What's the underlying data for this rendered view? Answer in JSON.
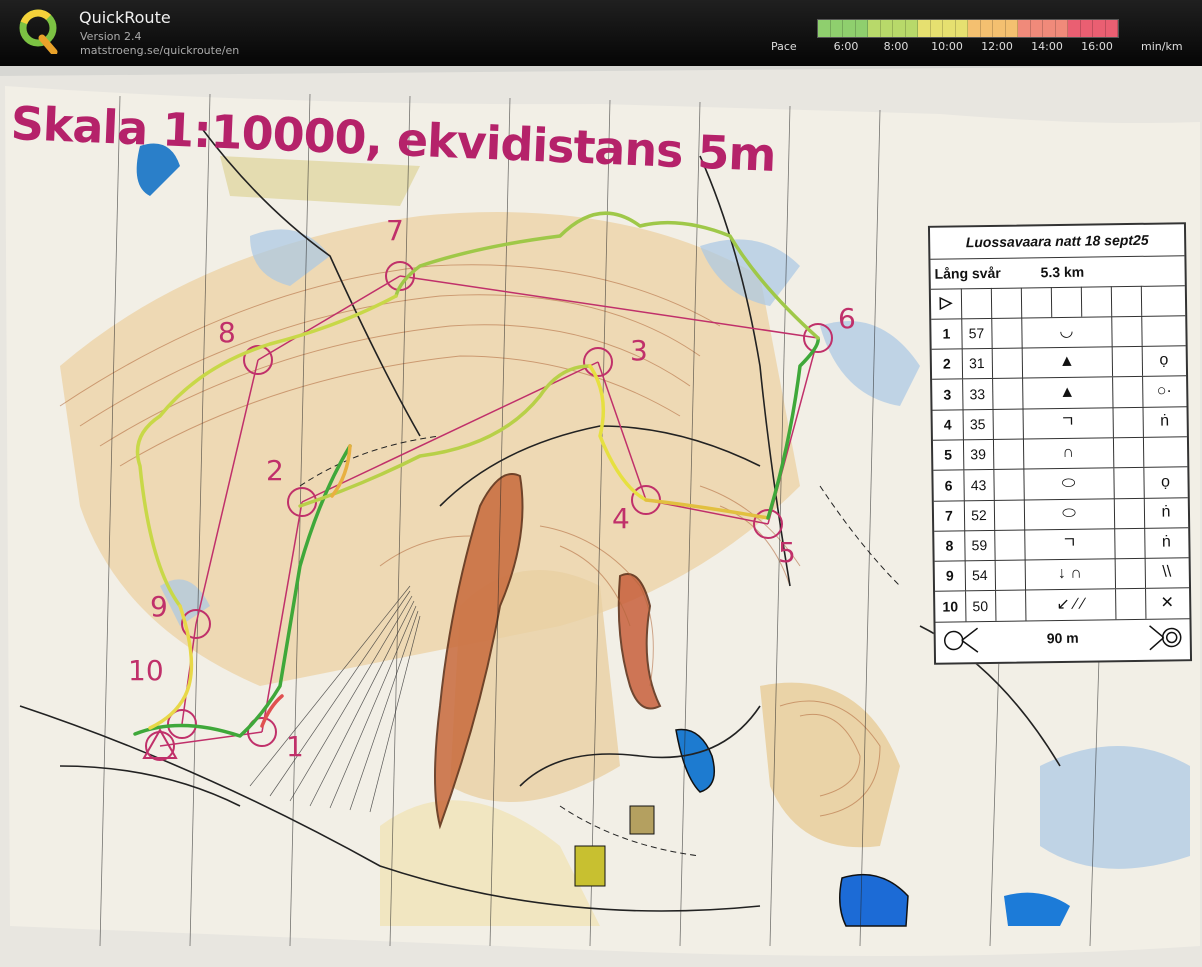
{
  "app": {
    "title": "QuickRoute",
    "version": "Version 2.4",
    "url": "matstroeng.se/quickroute/en"
  },
  "pace_legend": {
    "label": "Pace",
    "ticks": [
      "6:00",
      "8:00",
      "10:00",
      "12:00",
      "14:00",
      "16:00"
    ],
    "unit": "min/km",
    "gradient": [
      "#8fcf6e",
      "#b8d96a",
      "#e6e070",
      "#f4c070",
      "#f08a7a",
      "#ea5f72"
    ]
  },
  "map": {
    "title": "Skala 1:10000, ekvidistans 5m",
    "route_colors": {
      "fast": "#3fa83a",
      "medium": "#e8e040",
      "slow": "#e05050"
    },
    "course_color": "#c0306a",
    "controls": [
      {
        "label": "1"
      },
      {
        "label": "2"
      },
      {
        "label": "3"
      },
      {
        "label": "4"
      },
      {
        "label": "5"
      },
      {
        "label": "6"
      },
      {
        "label": "7"
      },
      {
        "label": "8"
      },
      {
        "label": "9"
      },
      {
        "label": "10"
      }
    ]
  },
  "description_sheet": {
    "event": "Luossavaara natt 18 sept25",
    "class": "Lång svår",
    "length": "5.3 km",
    "rows": [
      {
        "num": "1",
        "code": "57",
        "feature": "◡",
        "extra": ""
      },
      {
        "num": "2",
        "code": "31",
        "feature": "▲",
        "extra": "ọ"
      },
      {
        "num": "3",
        "code": "33",
        "feature": "▲",
        "extra": "○·"
      },
      {
        "num": "4",
        "code": "35",
        "feature": "ㄱ",
        "extra": "ṅ"
      },
      {
        "num": "5",
        "code": "39",
        "feature": "∩",
        "extra": ""
      },
      {
        "num": "6",
        "code": "43",
        "feature": "⬭",
        "extra": "ọ"
      },
      {
        "num": "7",
        "code": "52",
        "feature": "⬭",
        "extra": "ṅ"
      },
      {
        "num": "8",
        "code": "59",
        "feature": "ㄱ",
        "extra": "ṅ"
      },
      {
        "num": "9",
        "code": "54",
        "feature": "↓ ∩",
        "extra": "\\\\"
      },
      {
        "num": "10",
        "code": "50",
        "feature": "↙ ⁄ ⁄",
        "extra": "✕"
      }
    ],
    "finish_distance": "90 m"
  }
}
